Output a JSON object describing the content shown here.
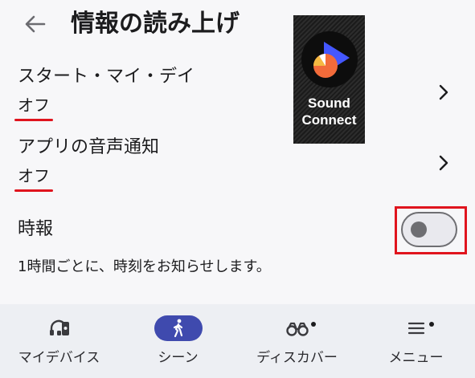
{
  "header": {
    "title": "情報の読み上げ",
    "back_icon": "arrow-left-icon"
  },
  "logo": {
    "line1": "Sound",
    "line2": "Connect",
    "colors": {
      "blue": "#4457ff",
      "orange": "#f26b3a",
      "yellow": "#f5b942"
    }
  },
  "settings": {
    "start_my_day": {
      "title": "スタート・マイ・デイ",
      "value": "オフ"
    },
    "app_voice_notification": {
      "title": "アプリの音声通知",
      "value": "オフ"
    },
    "hourly_chime": {
      "title": "時報",
      "enabled": false,
      "description": "1時間ごとに、時刻をお知らせします。"
    }
  },
  "highlight_color": "#e0141e",
  "nav": {
    "items": [
      {
        "label": "マイデバイス",
        "icon": "headphones-device-icon"
      },
      {
        "label": "シーン",
        "icon": "walking-person-icon",
        "selected": true
      },
      {
        "label": "ディスカバー",
        "icon": "binoculars-icon",
        "badge": true
      },
      {
        "label": "メニュー",
        "icon": "hamburger-menu-icon",
        "badge": true
      }
    ],
    "accent": "#3f4aae"
  }
}
